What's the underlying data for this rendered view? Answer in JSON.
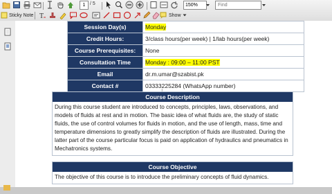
{
  "toolbar": {
    "page_number": "1",
    "page_total": "/ 5",
    "zoom": "150%",
    "find_placeholder": "Find",
    "sticky_note_label": "Sticky Note",
    "show_label": "Show"
  },
  "info_table": [
    {
      "label": "Session Day(s)",
      "value": "Monday",
      "highlight": true
    },
    {
      "label": "Credit Hours:",
      "value": "3/class hours(per week) | 1/lab hours(per week)",
      "highlight": false
    },
    {
      "label": "Course Prerequisites:",
      "value": "None",
      "highlight": false
    },
    {
      "label": "Consultation Time",
      "value": "Monday : 09:00 – 11:00 PST",
      "highlight": true
    },
    {
      "label": "Email",
      "value": "dr.m.umar@szabist.pk",
      "highlight": false
    },
    {
      "label": "Contact #",
      "value": "03333225284 (WhatsApp number)",
      "highlight": false
    }
  ],
  "course_description": {
    "title": "Course Description",
    "text": "During this course student are introduced to concepts, principles, laws, observations, and models of fluids at rest and in motion. The basic idea of what fluids are, the study of static fluids, the use of control volumes for fluids in motion, and the use of length, mass, time and temperature dimensions to greatly simplify the description of fluids are illustrated. During the latter part of the course particular focus is paid on application of hydraulics and pneumatics in Mechatronics systems."
  },
  "course_objective": {
    "title": "Course Objective",
    "text": "The objective of this course is to introduce the preliminary concepts of fluid dynamics."
  }
}
